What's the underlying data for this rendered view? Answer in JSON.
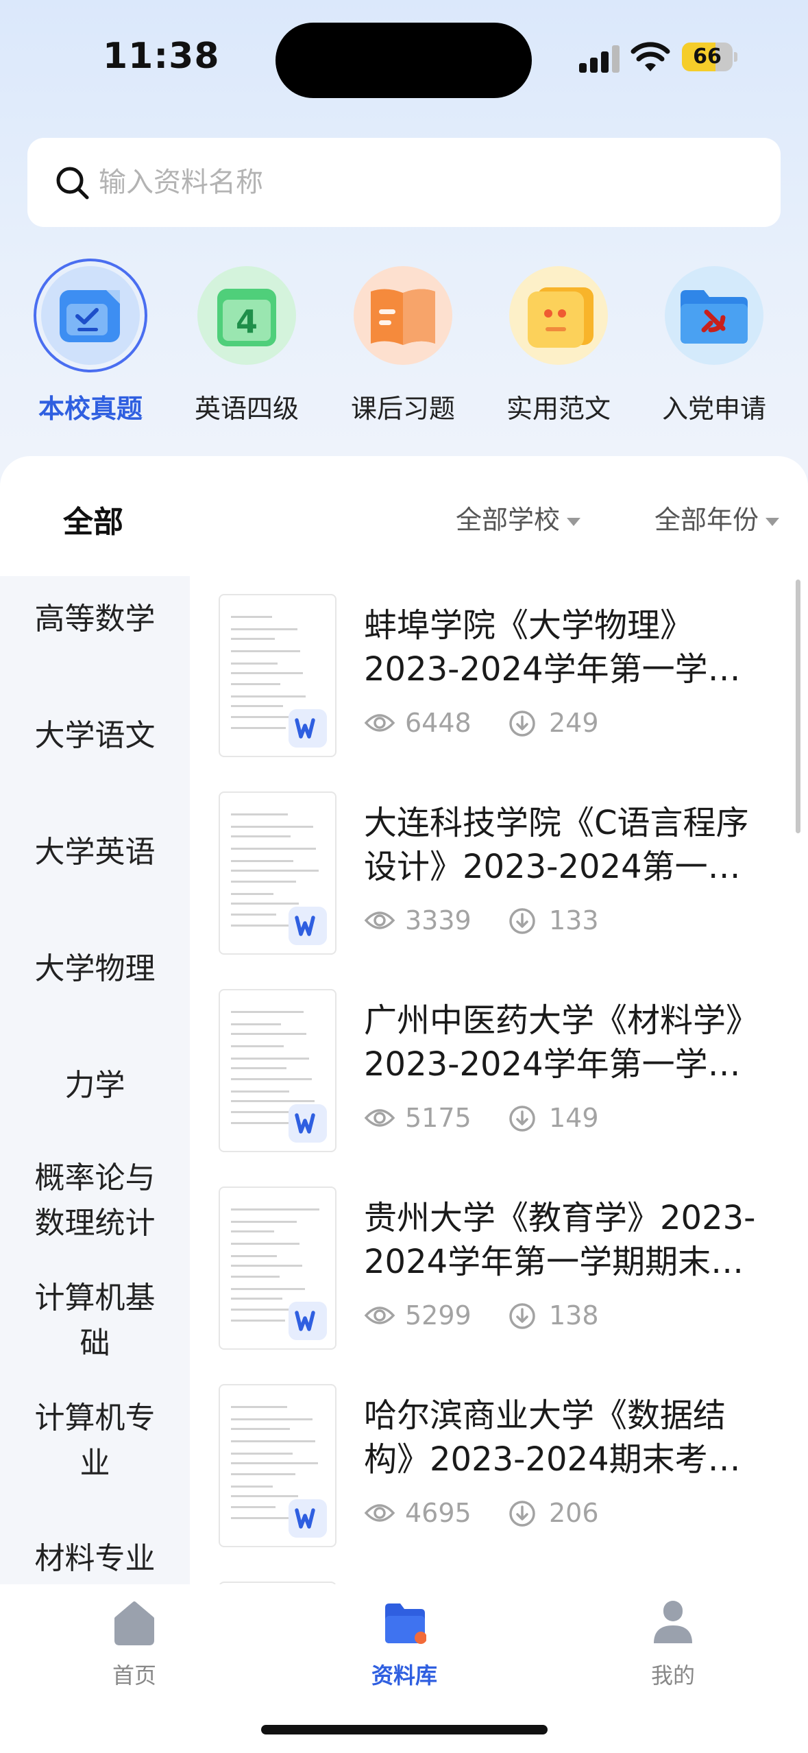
{
  "status": {
    "time": "11:38",
    "battery": "66",
    "battery_level": 0.66
  },
  "search": {
    "placeholder": "输入资料名称"
  },
  "categories": [
    {
      "label": "本校真题",
      "icon": "checklist-doc-icon"
    },
    {
      "label": "英语四级",
      "icon": "cet4-book-icon"
    },
    {
      "label": "课后习题",
      "icon": "open-book-icon"
    },
    {
      "label": "实用范文",
      "icon": "quote-card-icon"
    },
    {
      "label": "入党申请",
      "icon": "party-folder-icon"
    }
  ],
  "filters": {
    "all": "全部",
    "school": "全部学校",
    "year": "全部年份"
  },
  "sidebar": {
    "items": [
      [
        "高等数学"
      ],
      [
        "大学语文"
      ],
      [
        "大学英语"
      ],
      [
        "大学物理"
      ],
      [
        "力学"
      ],
      [
        "概率论与",
        "数理统计"
      ],
      [
        "计算机基",
        "础"
      ],
      [
        "计算机专",
        "业"
      ],
      [
        "材料专业"
      ]
    ]
  },
  "documents": [
    {
      "title_line1": "蚌埠学院《大学物理》",
      "title_line2": "2023-2024学年第一学…",
      "views": "6448",
      "downloads": "249"
    },
    {
      "title_line1": "大连科技学院《C语言程序",
      "title_line2": "设计》2023-2024第一…",
      "views": "3339",
      "downloads": "133"
    },
    {
      "title_line1": "广州中医药大学《材料学》",
      "title_line2": "2023-2024学年第一学…",
      "views": "5175",
      "downloads": "149"
    },
    {
      "title_line1": "贵州大学《教育学》2023-",
      "title_line2": "2024学年第一学期期末…",
      "views": "5299",
      "downloads": "138"
    },
    {
      "title_line1": "哈尔滨商业大学《数据结",
      "title_line2": "构》2023-2024期末考…",
      "views": "4695",
      "downloads": "206"
    }
  ],
  "tabs": [
    {
      "label": "首页",
      "icon": "home-icon"
    },
    {
      "label": "资料库",
      "icon": "folder-icon"
    },
    {
      "label": "我的",
      "icon": "person-icon"
    }
  ],
  "colors": {
    "accent": "#2f5fe0",
    "muted": "#a3a3a3"
  }
}
